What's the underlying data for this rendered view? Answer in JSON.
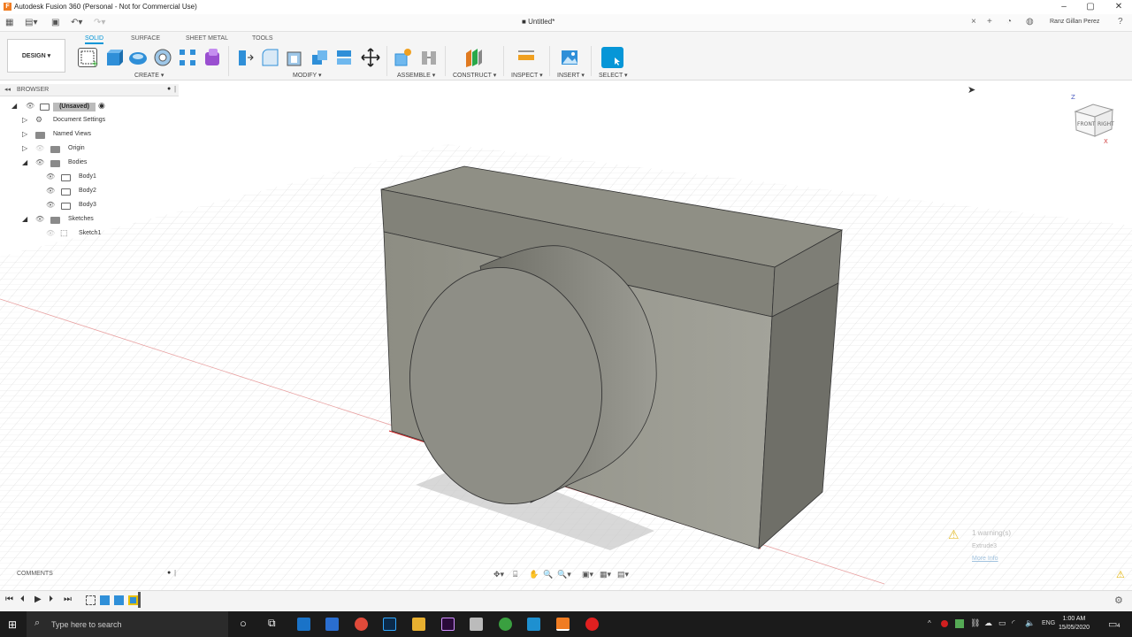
{
  "window": {
    "title": "Autodesk Fusion 360 (Personal - Not for Commercial Use)",
    "app_letter": "F"
  },
  "document": {
    "tab_title": "Untitled*"
  },
  "user": {
    "name": "Ranz Gillan Perez"
  },
  "workspace": {
    "mode": "DESIGN"
  },
  "tabs": [
    "SOLID",
    "SURFACE",
    "SHEET METAL",
    "TOOLS"
  ],
  "groups": {
    "create": "CREATE",
    "modify": "MODIFY",
    "assemble": "ASSEMBLE",
    "construct": "CONSTRUCT",
    "inspect": "INSPECT",
    "insert": "INSERT",
    "select": "SELECT"
  },
  "browser": {
    "header": "BROWSER",
    "root": "(Unsaved)",
    "items": {
      "document_settings": "Document Settings",
      "named_views": "Named Views",
      "origin": "Origin",
      "bodies": "Bodies",
      "body1": "Body1",
      "body2": "Body2",
      "body3": "Body3",
      "sketches": "Sketches",
      "sketch1": "Sketch1"
    }
  },
  "viewcube": {
    "front": "FRONT",
    "right": "RIGHT",
    "axis_z": "Z",
    "axis_x": "X"
  },
  "comments": {
    "label": "COMMENTS"
  },
  "warning": {
    "title": "1 warning(s)",
    "detail": "Extrude3",
    "link": "More Info"
  },
  "taskbar": {
    "search_placeholder": "Type here to search",
    "language": "ENG",
    "time": "1:00 AM",
    "date": "15/05/2020",
    "notification_count": "4"
  },
  "colors": {
    "accent": "#0696d7",
    "body_face": "#8b8b80"
  }
}
